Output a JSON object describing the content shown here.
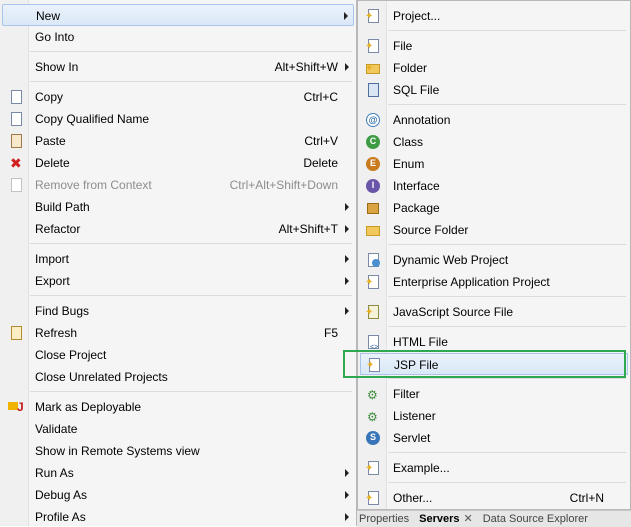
{
  "context_menu": {
    "items": [
      {
        "label": "New",
        "shortcut": "",
        "submenu": true,
        "icon": "new-icon",
        "enabled": true
      },
      {
        "label": "Go Into",
        "shortcut": "",
        "submenu": false,
        "icon": "",
        "enabled": true
      },
      {
        "label": "Show In",
        "shortcut": "Alt+Shift+W",
        "submenu": true,
        "icon": "",
        "enabled": true
      },
      {
        "label": "Copy",
        "shortcut": "Ctrl+C",
        "submenu": false,
        "icon": "copy-icon",
        "enabled": true
      },
      {
        "label": "Copy Qualified Name",
        "shortcut": "",
        "submenu": false,
        "icon": "copy-icon",
        "enabled": true
      },
      {
        "label": "Paste",
        "shortcut": "Ctrl+V",
        "submenu": false,
        "icon": "paste-icon",
        "enabled": true
      },
      {
        "label": "Delete",
        "shortcut": "Delete",
        "submenu": false,
        "icon": "delete-icon",
        "enabled": true
      },
      {
        "label": "Remove from Context",
        "shortcut": "Ctrl+Alt+Shift+Down",
        "submenu": false,
        "icon": "remove-context-icon",
        "enabled": false
      },
      {
        "label": "Build Path",
        "shortcut": "",
        "submenu": true,
        "icon": "",
        "enabled": true
      },
      {
        "label": "Refactor",
        "shortcut": "Alt+Shift+T",
        "submenu": true,
        "icon": "",
        "enabled": true
      },
      {
        "label": "Import",
        "shortcut": "",
        "submenu": true,
        "icon": "",
        "enabled": true
      },
      {
        "label": "Export",
        "shortcut": "",
        "submenu": true,
        "icon": "",
        "enabled": true
      },
      {
        "label": "Find Bugs",
        "shortcut": "",
        "submenu": true,
        "icon": "",
        "enabled": true
      },
      {
        "label": "Refresh",
        "shortcut": "F5",
        "submenu": false,
        "icon": "refresh-icon",
        "enabled": true
      },
      {
        "label": "Close Project",
        "shortcut": "",
        "submenu": false,
        "icon": "",
        "enabled": true
      },
      {
        "label": "Close Unrelated Projects",
        "shortcut": "",
        "submenu": false,
        "icon": "",
        "enabled": true
      },
      {
        "label": "Mark as Deployable",
        "shortcut": "",
        "submenu": false,
        "icon": "deploy-icon",
        "enabled": true
      },
      {
        "label": "Validate",
        "shortcut": "",
        "submenu": false,
        "icon": "",
        "enabled": true
      },
      {
        "label": "Show in Remote Systems view",
        "shortcut": "",
        "submenu": false,
        "icon": "",
        "enabled": true
      },
      {
        "label": "Run As",
        "shortcut": "",
        "submenu": true,
        "icon": "",
        "enabled": true
      },
      {
        "label": "Debug As",
        "shortcut": "",
        "submenu": true,
        "icon": "",
        "enabled": true
      },
      {
        "label": "Profile As",
        "shortcut": "",
        "submenu": true,
        "icon": "",
        "enabled": true
      }
    ]
  },
  "sub_menu": {
    "items": [
      {
        "label": "Project...",
        "shortcut": "",
        "icon": "project-icon"
      },
      {
        "label": "File",
        "shortcut": "",
        "icon": "file-icon"
      },
      {
        "label": "Folder",
        "shortcut": "",
        "icon": "folder-icon"
      },
      {
        "label": "SQL File",
        "shortcut": "",
        "icon": "sql-file-icon"
      },
      {
        "label": "Annotation",
        "shortcut": "",
        "icon": "annotation-icon"
      },
      {
        "label": "Class",
        "shortcut": "",
        "icon": "class-icon"
      },
      {
        "label": "Enum",
        "shortcut": "",
        "icon": "enum-icon"
      },
      {
        "label": "Interface",
        "shortcut": "",
        "icon": "interface-icon"
      },
      {
        "label": "Package",
        "shortcut": "",
        "icon": "package-icon"
      },
      {
        "label": "Source Folder",
        "shortcut": "",
        "icon": "source-folder-icon"
      },
      {
        "label": "Dynamic Web Project",
        "shortcut": "",
        "icon": "web-project-icon"
      },
      {
        "label": "Enterprise Application Project",
        "shortcut": "",
        "icon": "ear-project-icon"
      },
      {
        "label": "JavaScript Source File",
        "shortcut": "",
        "icon": "javascript-file-icon"
      },
      {
        "label": "HTML File",
        "shortcut": "",
        "icon": "html-file-icon"
      },
      {
        "label": "JSP File",
        "shortcut": "",
        "icon": "jsp-file-icon"
      },
      {
        "label": "Filter",
        "shortcut": "",
        "icon": "filter-icon"
      },
      {
        "label": "Listener",
        "shortcut": "",
        "icon": "listener-icon"
      },
      {
        "label": "Servlet",
        "shortcut": "",
        "icon": "servlet-icon"
      },
      {
        "label": "Example...",
        "shortcut": "",
        "icon": "example-icon"
      },
      {
        "label": "Other...",
        "shortcut": "Ctrl+N",
        "icon": "other-icon"
      }
    ]
  },
  "bottom_tabs": {
    "properties": "Properties",
    "servers": "Servers",
    "close": "✕",
    "data_source": "Data Source Explorer"
  }
}
